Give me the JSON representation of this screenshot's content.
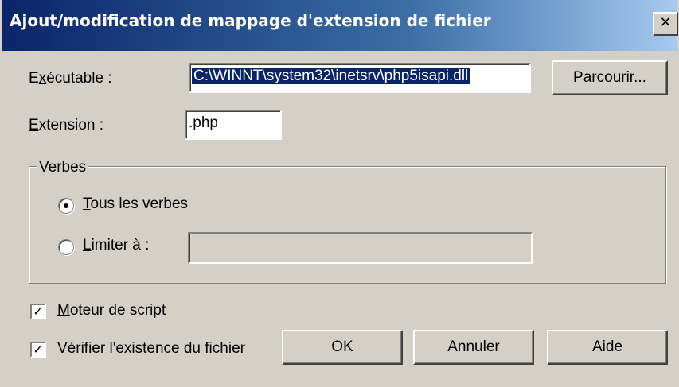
{
  "window": {
    "title": "Ajout/modification de mappage d'extension de fichier",
    "close_glyph": "✕"
  },
  "executable": {
    "label_pre": "E",
    "label_ul": "x",
    "label_post": "écutable :",
    "value": "C:\\WINNT\\system32\\inetsrv\\php5isapi.dll",
    "browse_pre": "",
    "browse_ul": "P",
    "browse_post": "arcourir..."
  },
  "extension": {
    "label_ul": "E",
    "label_post": "xtension :",
    "value": ".php"
  },
  "verbs": {
    "group_label": "Verbes",
    "all_ul": "T",
    "all_post": "ous les verbes",
    "limit_ul": "L",
    "limit_post": "imiter à :",
    "limit_value": "",
    "selected": "all"
  },
  "options": {
    "script_engine_ul": "M",
    "script_engine_post": "oteur de script",
    "script_engine_checked": true,
    "verify_pre": "Véri",
    "verify_ul": "f",
    "verify_post": "ier l'existence du fichier",
    "verify_checked": true,
    "check_glyph": "✓"
  },
  "buttons": {
    "ok": "OK",
    "cancel": "Annuler",
    "help": "Aide"
  },
  "colors": {
    "title_start": "#0a246a",
    "title_end": "#a6caf0",
    "face": "#d4d0c8",
    "selection": "#0a246a"
  }
}
